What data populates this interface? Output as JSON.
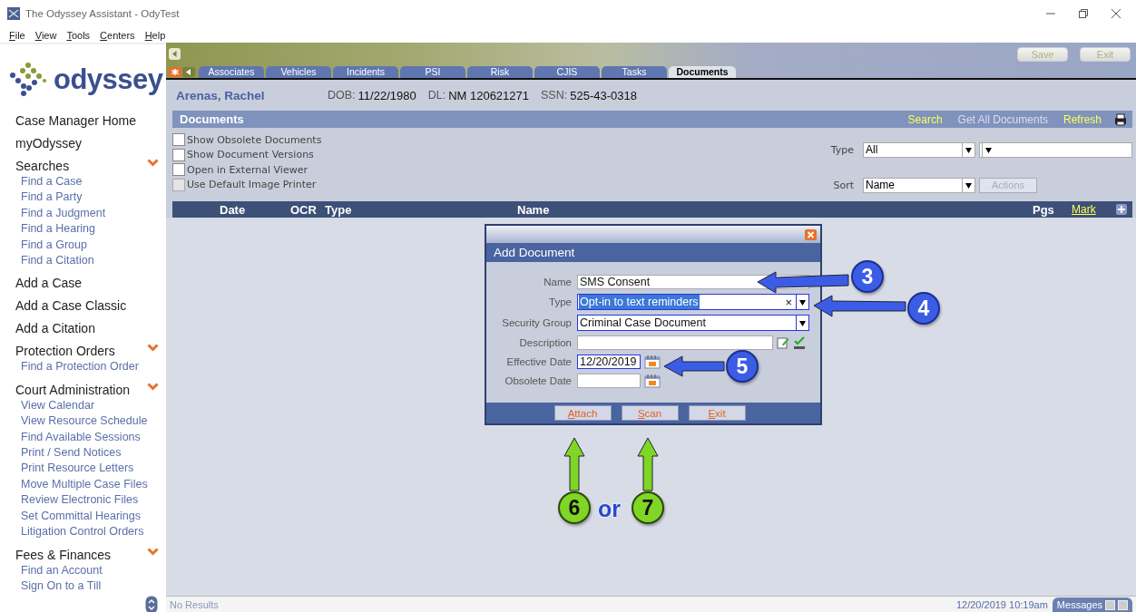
{
  "window": {
    "title": "The Odyssey Assistant - OdyTest"
  },
  "menu": [
    "File",
    "View",
    "Tools",
    "Centers",
    "Help"
  ],
  "sidebar": {
    "logo_text": "odyssey",
    "entries": [
      {
        "kind": "link",
        "label": "Case Manager Home"
      },
      {
        "kind": "link",
        "label": "myOdyssey"
      },
      {
        "kind": "section",
        "label": "Searches",
        "children": [
          "Find a Case",
          "Find a Party",
          "Find a Judgment",
          "Find a Hearing",
          "Find a Group",
          "Find a Citation"
        ]
      },
      {
        "kind": "link",
        "label": "Add a Case"
      },
      {
        "kind": "link",
        "label": "Add a Case Classic"
      },
      {
        "kind": "link",
        "label": "Add a Citation"
      },
      {
        "kind": "section",
        "label": "Protection Orders",
        "children": [
          "Find a Protection Order"
        ]
      },
      {
        "kind": "section",
        "label": "Court Administration",
        "children": [
          "View Calendar",
          "View Resource Schedule",
          "Find Available Sessions",
          "Print / Send Notices",
          "Print Resource Letters",
          "Move Multiple Case Files",
          "Review Electronic Files",
          "Set Committal Hearings",
          "Litigation Control Orders"
        ]
      },
      {
        "kind": "section",
        "label": "Fees & Finances",
        "children": [
          "Find an Account",
          "Sign On to a Till"
        ]
      }
    ]
  },
  "header_buttons": [
    {
      "label": "Save",
      "disabled": true
    },
    {
      "label": "Exit",
      "disabled": true
    }
  ],
  "tabs": [
    {
      "label": "Associates",
      "selected": false
    },
    {
      "label": "Vehicles",
      "selected": false
    },
    {
      "label": "Incidents",
      "selected": false
    },
    {
      "label": "PSI",
      "selected": false
    },
    {
      "label": "Risk",
      "selected": false
    },
    {
      "label": "CJIS",
      "selected": false
    },
    {
      "label": "Tasks",
      "selected": false
    },
    {
      "label": "Documents",
      "selected": true
    }
  ],
  "person": {
    "name": "Arenas, Rachel",
    "fields": [
      {
        "label": "DOB:",
        "value": "11/22/1980"
      },
      {
        "label": "DL:",
        "value": "NM 120621271"
      },
      {
        "label": "SSN:",
        "value": "525-43-0318"
      }
    ]
  },
  "documents": {
    "title": "Documents",
    "actions": [
      {
        "label": "Search",
        "disabled": false
      },
      {
        "label": "Get All Documents",
        "disabled": true
      },
      {
        "label": "Refresh",
        "disabled": false
      }
    ],
    "options": [
      {
        "label": "Show Obsolete Documents",
        "checked": false,
        "disabled": false
      },
      {
        "label": "Show Document Versions",
        "checked": false,
        "disabled": false
      },
      {
        "label": "Open in External Viewer",
        "checked": false,
        "disabled": false
      },
      {
        "label": "Use Default Image Printer",
        "checked": false,
        "disabled": true
      }
    ],
    "type_label": "Type",
    "type_value": "All",
    "sort_label": "Sort",
    "sort_value": "Name",
    "actions_button": {
      "label": "Actions",
      "disabled": true
    },
    "columns": [
      {
        "label": "Date",
        "kind": "header"
      },
      {
        "label": "OCR",
        "kind": "header"
      },
      {
        "label": "Type",
        "kind": "header"
      },
      {
        "label": "Name",
        "kind": "header"
      },
      {
        "label": "Pgs",
        "kind": "header"
      },
      {
        "label": "Mark",
        "kind": "link"
      }
    ]
  },
  "dialog": {
    "title": "Add Document",
    "fields": [
      {
        "label": "Name",
        "kind": "text",
        "value": "SMS Consent"
      },
      {
        "label": "Type",
        "kind": "select",
        "value": "Opt-in to text reminders",
        "selected_text": true,
        "clear": "×"
      },
      {
        "label": "Security Group",
        "kind": "select",
        "value": "Criminal Case Document",
        "selected_text": false
      },
      {
        "label": "Description",
        "kind": "memo"
      },
      {
        "label": "Effective Date",
        "kind": "date",
        "value": "12/20/2019"
      },
      {
        "label": "Obsolete Date",
        "kind": "date"
      }
    ],
    "buttons": [
      "Attach",
      "Scan",
      "Exit"
    ]
  },
  "callouts": [
    {
      "label": "3",
      "color": "#3b5de6"
    },
    {
      "label": "4",
      "color": "#3b5de6"
    },
    {
      "label": "5",
      "color": "#3b5de6"
    },
    {
      "label": "6",
      "color": "#7fd624"
    },
    {
      "label": "7",
      "color": "#7fd624"
    }
  ],
  "callout_joiner": "or",
  "status_bar": {
    "message": "No Results",
    "datetime": "12/20/2019 10:19am",
    "messages_tab": "Messages"
  }
}
